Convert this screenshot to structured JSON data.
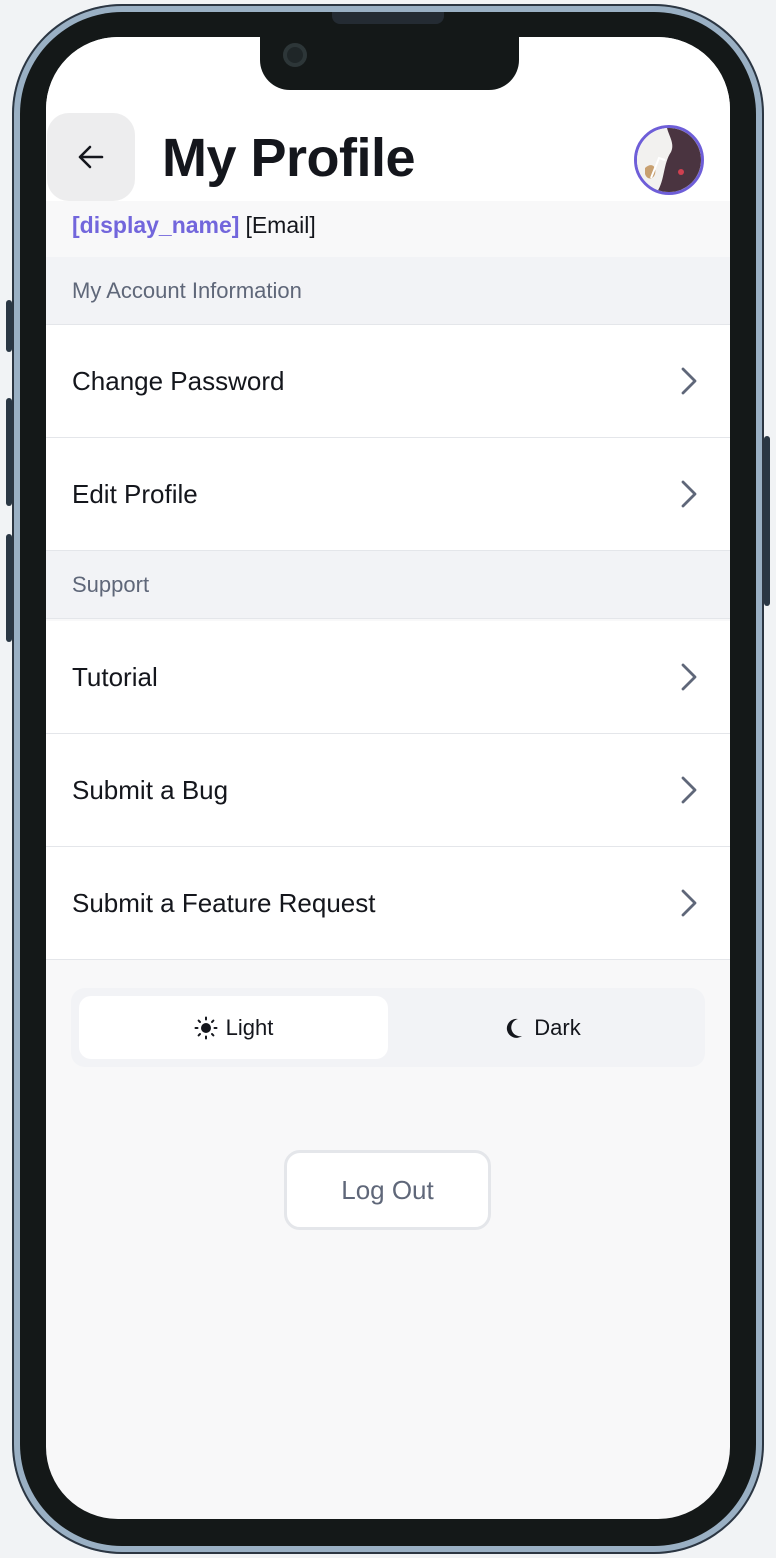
{
  "header": {
    "title": "My Profile",
    "back_icon": "arrow-left-icon",
    "avatar_icon": "user-avatar"
  },
  "user": {
    "display_name": "[display_name]",
    "email": "[Email]"
  },
  "sections": [
    {
      "title": "My Account Information",
      "items": [
        {
          "label": "Change Password",
          "icon": "chevron-right-icon"
        },
        {
          "label": "Edit Profile",
          "icon": "chevron-right-icon"
        }
      ]
    },
    {
      "title": "Support",
      "items": [
        {
          "label": "Tutorial",
          "icon": "chevron-right-icon"
        },
        {
          "label": "Submit a Bug",
          "icon": "chevron-right-icon"
        },
        {
          "label": "Submit a Feature Request",
          "icon": "chevron-right-icon"
        }
      ]
    }
  ],
  "theme": {
    "light_label": "Light",
    "dark_label": "Dark",
    "selected": "Light",
    "light_icon": "sun-icon",
    "dark_icon": "moon-icon"
  },
  "logout_label": "Log Out",
  "colors": {
    "accent": "#7266dc",
    "text": "#14161c",
    "muted": "#5f6779",
    "section_bg": "#f2f3f6"
  }
}
